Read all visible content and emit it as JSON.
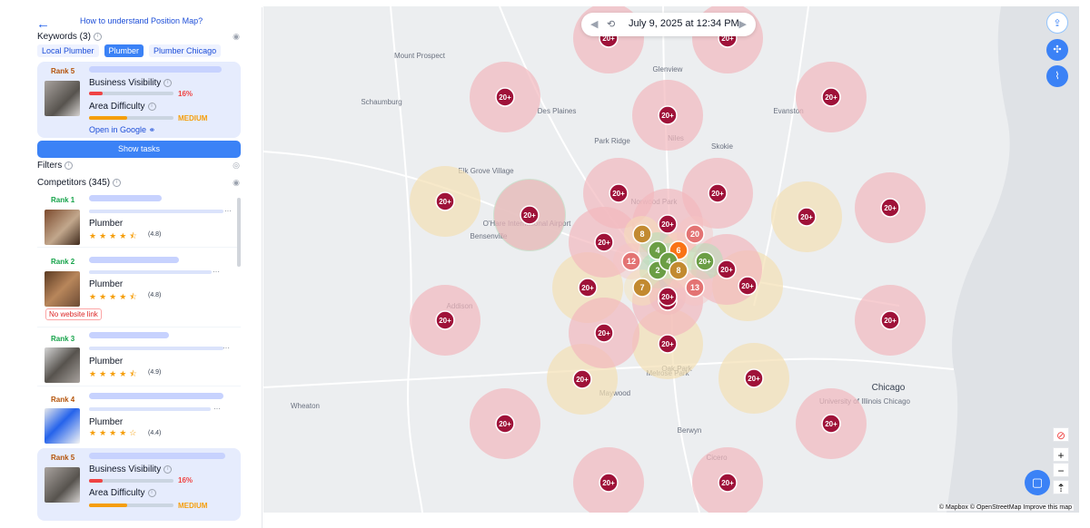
{
  "header": {
    "back_icon": "arrow-left-icon",
    "help_link": "How to understand Position Map?"
  },
  "keywords": {
    "label": "Keywords (3)",
    "items": [
      {
        "label": "Local Plumber",
        "active": false
      },
      {
        "label": "Plumber",
        "active": true
      },
      {
        "label": "Plumber Chicago",
        "active": false
      }
    ]
  },
  "business": {
    "rank": "Rank 5",
    "visibility_label": "Business Visibility",
    "visibility_value": "16%",
    "visibility_fraction": 0.16,
    "difficulty_label": "Area Difficulty",
    "difficulty_value": "MEDIUM",
    "difficulty_fraction": 0.45,
    "open_link": "Open in Google"
  },
  "show_tasks": "Show tasks",
  "filters_label": "Filters",
  "competitors": {
    "label": "Competitors (345)",
    "items": [
      {
        "rank": "Rank 1",
        "category": "Plumber",
        "stars": "★★★★⯪",
        "rating": "(4.8)"
      },
      {
        "rank": "Rank 2",
        "category": "Plumber",
        "stars": "★★★★⯪",
        "rating": "(4.8)",
        "badge": "No website link"
      },
      {
        "rank": "Rank 3",
        "category": "Plumber",
        "stars": "★★★★⯪",
        "rating": "(4.9)"
      },
      {
        "rank": "Rank 4",
        "category": "Plumber",
        "stars": "★★★★☆",
        "rating": "(4.4)"
      }
    ]
  },
  "business_bottom": {
    "rank": "Rank 5",
    "visibility_label": "Business Visibility",
    "visibility_value": "16%",
    "difficulty_label": "Area Difficulty",
    "difficulty_value": "MEDIUM"
  },
  "map": {
    "date": "July 9, 2025 at 12:34 PM",
    "attribution": "© Mapbox © OpenStreetMap  Improve this map",
    "places": [
      "Mount Prospect",
      "Glenview",
      "Evanston",
      "Schaumburg",
      "Des Plaines",
      "Niles",
      "Skokie",
      "Park Ridge",
      "Elk Grove Village",
      "O'Hare International Airport",
      "Bensenville",
      "Norwood Park",
      "Addison",
      "Melrose Park",
      "Maywood",
      "Oak Park",
      "Wheaton",
      "Chicago",
      "University of Illinois Chicago",
      "Berwyn",
      "Cicero"
    ],
    "pins": [
      {
        "label": "20+",
        "level": "red"
      },
      {
        "label": "20+",
        "level": "red"
      },
      {
        "label": "20+",
        "level": "red"
      },
      {
        "label": "20+",
        "level": "red"
      },
      {
        "label": "20+",
        "level": "red"
      },
      {
        "label": "20+",
        "level": "red"
      },
      {
        "label": "20+",
        "level": "red"
      },
      {
        "label": "20+",
        "level": "red"
      },
      {
        "label": "20+",
        "level": "red"
      },
      {
        "label": "20+",
        "level": "red"
      },
      {
        "label": "20+",
        "level": "red"
      },
      {
        "label": "20+",
        "level": "red"
      },
      {
        "label": "20+",
        "level": "red"
      },
      {
        "label": "20+",
        "level": "red"
      },
      {
        "label": "20+",
        "level": "red"
      },
      {
        "label": "20+",
        "level": "red"
      },
      {
        "label": "20+",
        "level": "red"
      },
      {
        "label": "20+",
        "level": "red"
      },
      {
        "label": "20+",
        "level": "red"
      },
      {
        "label": "20+",
        "level": "red"
      },
      {
        "label": "20+",
        "level": "red"
      },
      {
        "label": "20+",
        "level": "red"
      },
      {
        "label": "20+",
        "level": "red"
      },
      {
        "label": "20+",
        "level": "red"
      },
      {
        "label": "20+",
        "level": "red"
      },
      {
        "label": "20+",
        "level": "red"
      },
      {
        "label": "20+",
        "level": "red"
      },
      {
        "label": "8",
        "level": "amber"
      },
      {
        "label": "4",
        "level": "green"
      },
      {
        "label": "6",
        "level": "orange"
      },
      {
        "label": "20",
        "level": "rose"
      },
      {
        "label": "12",
        "level": "rose"
      },
      {
        "label": "2",
        "level": "green"
      },
      {
        "label": "4",
        "level": "green"
      },
      {
        "label": "8",
        "level": "amber"
      },
      {
        "label": "20+",
        "level": "green"
      },
      {
        "label": "7",
        "level": "amber"
      },
      {
        "label": "20+",
        "level": "red"
      },
      {
        "label": "13",
        "level": "rose"
      }
    ]
  },
  "colors": {
    "accent": "#3b82f6",
    "red_pin": "#b91c1c",
    "green_pin": "#16a34a",
    "amber": "#f59e0b"
  }
}
